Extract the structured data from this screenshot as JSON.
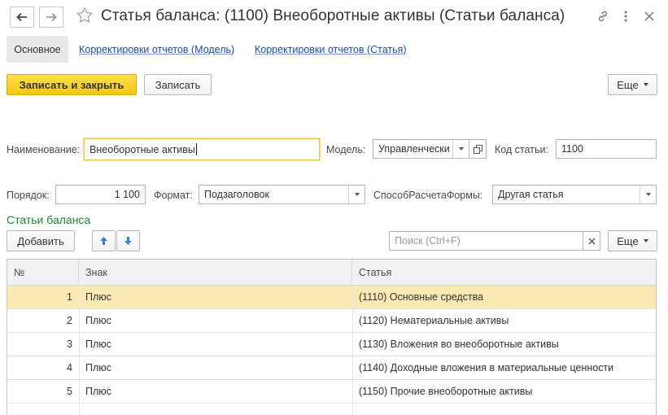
{
  "window": {
    "title": "Статья баланса: (1100) Внеоборотные активы (Статьи баланса)",
    "icons": [
      "back-arrow-icon",
      "forward-arrow-icon",
      "star-icon",
      "link-icon",
      "more-vertical-icon",
      "close-icon"
    ]
  },
  "tabs": {
    "main": "Основное",
    "link1": "Корректировки отчетов (Модель)",
    "link2": "Корректировки отчетов (Статья)"
  },
  "toolbar": {
    "save_close": "Записать и закрыть",
    "save": "Записать",
    "more": "Еще"
  },
  "form": {
    "name_label": "Наименование:",
    "name_value": "Внеоборотные активы",
    "model_label": "Модель:",
    "model_value": "Управленчески",
    "code_label": "Код статьи:",
    "code_value": "1100",
    "order_label": "Порядок:",
    "order_value": "1 100",
    "format_label": "Формат:",
    "format_value": "Подзаголовок",
    "calc_label": "СпособРасчетаФормы:",
    "calc_value": "Другая статья"
  },
  "section": {
    "title": "Статьи баланса",
    "add": "Добавить",
    "search_placeholder": "Поиск (Ctrl+F)",
    "more": "Еще"
  },
  "table": {
    "columns": [
      "№",
      "Знак",
      "Статья"
    ],
    "rows": [
      {
        "n": "1",
        "sign": "Плюс",
        "article": "(1110) Основные средства",
        "selected": true
      },
      {
        "n": "2",
        "sign": "Плюс",
        "article": "(1120) Нематериальные активы",
        "selected": false
      },
      {
        "n": "3",
        "sign": "Плюс",
        "article": "(1130) Вложения во внеоборотные активы",
        "selected": false
      },
      {
        "n": "4",
        "sign": "Плюс",
        "article": "(1140) Доходные вложения в материальные ценности",
        "selected": false
      },
      {
        "n": "5",
        "sign": "Плюс",
        "article": "(1150) Прочие внеоборотные активы",
        "selected": false
      }
    ]
  },
  "colors": {
    "primary_button": "#f3c614",
    "section_title": "#1a8a2f",
    "link": "#1c4ea8",
    "selected_row": "#fbe9b3",
    "arrow_icons": "#3b7fd0"
  }
}
